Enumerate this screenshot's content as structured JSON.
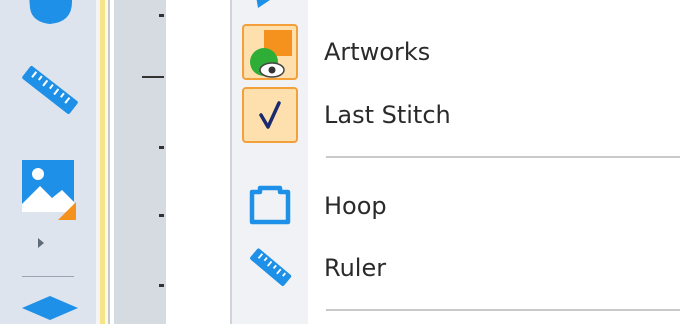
{
  "menu": {
    "items": [
      {
        "label": "Artworks",
        "icon": "artworks-icon",
        "checked": true
      },
      {
        "label": "Last Stitch",
        "icon": "checkmark-icon",
        "checked": true
      },
      {
        "label": "Hoop",
        "icon": "hoop-icon",
        "checked": false
      },
      {
        "label": "Ruler",
        "icon": "ruler-icon",
        "checked": false
      }
    ]
  },
  "toolbar": {
    "icons": [
      "hand-icon",
      "ruler-icon",
      "image-icon",
      "expand-arrow-icon",
      "layer-icon"
    ]
  },
  "colors": {
    "accent_blue": "#1e90e8",
    "check_bg": "#fde0ad",
    "check_border": "#f4a03a",
    "artwork_orange": "#f5921e",
    "artwork_green": "#2fae37"
  }
}
